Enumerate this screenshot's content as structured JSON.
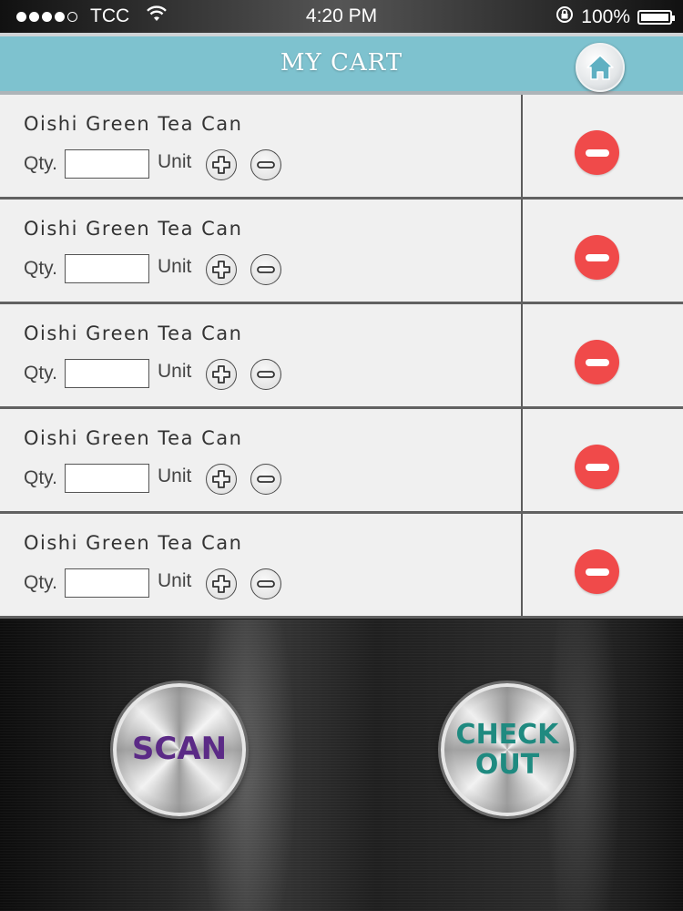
{
  "status_bar": {
    "carrier": "TCC",
    "time": "4:20 PM",
    "battery": "100%",
    "signal_bars_filled": 4,
    "signal_bars_total": 5
  },
  "header": {
    "title": "MY CART",
    "home_icon": "home-icon"
  },
  "cart": {
    "items": [
      {
        "name": "Oishi Green Tea Can",
        "qty_label": "Qty.",
        "qty_value": "",
        "unit_label": "Unit"
      },
      {
        "name": "Oishi Green Tea Can",
        "qty_label": "Qty.",
        "qty_value": "",
        "unit_label": "Unit"
      },
      {
        "name": "Oishi Green Tea Can",
        "qty_label": "Qty.",
        "qty_value": "",
        "unit_label": "Unit"
      },
      {
        "name": "Oishi Green Tea Can",
        "qty_label": "Qty.",
        "qty_value": "",
        "unit_label": "Unit"
      },
      {
        "name": "Oishi Green Tea Can",
        "qty_label": "Qty.",
        "qty_value": "",
        "unit_label": "Unit"
      }
    ]
  },
  "actions": {
    "scan_label": "SCAN",
    "checkout_line1": "CHECK",
    "checkout_line2": "OUT"
  },
  "colors": {
    "header_bg": "#7ec2cf",
    "remove": "#f04a4a",
    "scan_text": "#5b2a86",
    "checkout_text": "#1f8a80"
  }
}
